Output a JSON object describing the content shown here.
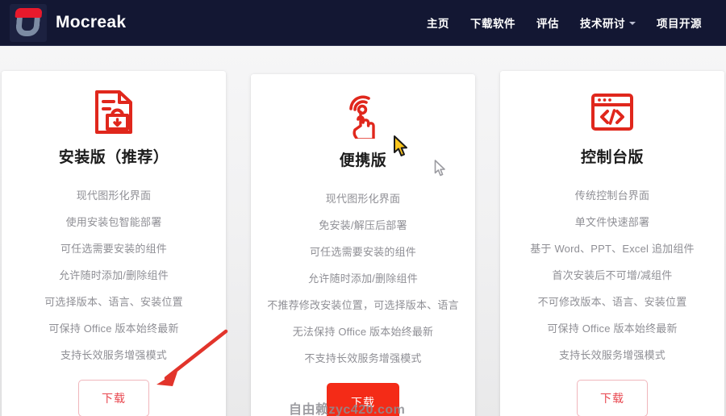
{
  "header": {
    "brand_name": "Mocreak",
    "logo_icon": "mocreak-u-logo",
    "nav": [
      {
        "label": "主页",
        "has_dropdown": false
      },
      {
        "label": "下载软件",
        "has_dropdown": false
      },
      {
        "label": "评估",
        "has_dropdown": false
      },
      {
        "label": "技术研讨",
        "has_dropdown": true
      },
      {
        "label": "项目开源",
        "has_dropdown": false
      }
    ]
  },
  "cards": [
    {
      "icon": "document-lock-download-icon",
      "title": "安装版（推荐）",
      "features": [
        "现代图形化界面",
        "使用安装包智能部署",
        "可任选需要安装的组件",
        "允许随时添加/删除组件",
        "可选择版本、语言、安装位置",
        "可保持 Office 版本始终最新",
        "支持长效服务增强模式"
      ],
      "button_label": "下载",
      "button_style": "outline"
    },
    {
      "icon": "touch-tap-hand-icon",
      "title": "便携版",
      "features": [
        "现代图形化界面",
        "免安装/解压后部署",
        "可任选需要安装的组件",
        "允许随时添加/删除组件",
        "不推荐修改安装位置，可选择版本、语言",
        "无法保持 Office 版本始终最新",
        "不支持长效服务增强模式"
      ],
      "button_label": "下载",
      "button_style": "filled"
    },
    {
      "icon": "console-code-window-icon",
      "title": "控制台版",
      "features": [
        "传统控制台界面",
        "单文件快速部署",
        "基于 Word、PPT、Excel 追加组件",
        "首次安装后不可增/减组件",
        "不可修改版本、语言、安装位置",
        "可保持 Office 版本始终最新",
        "支持长效服务增强模式"
      ],
      "button_label": "下载",
      "button_style": "outline"
    }
  ],
  "annotations": {
    "arrow_icon": "red-pointer-arrow",
    "cursor_primary_icon": "yellow-mouse-pointer",
    "cursor_secondary_icon": "gray-mouse-pointer",
    "watermark": "自由赖zyc420.com"
  },
  "colors": {
    "header_bg": "#131733",
    "accent_red": "#f42b17",
    "logo_red": "#e8192c",
    "logo_gray": "#7c8ba3",
    "feature_text": "#8f8f95",
    "title_text": "#1c1c1c",
    "outline_btn_border": "#f0b6bc",
    "outline_btn_text": "#e8474f",
    "page_bg": "#f1f1f2"
  }
}
